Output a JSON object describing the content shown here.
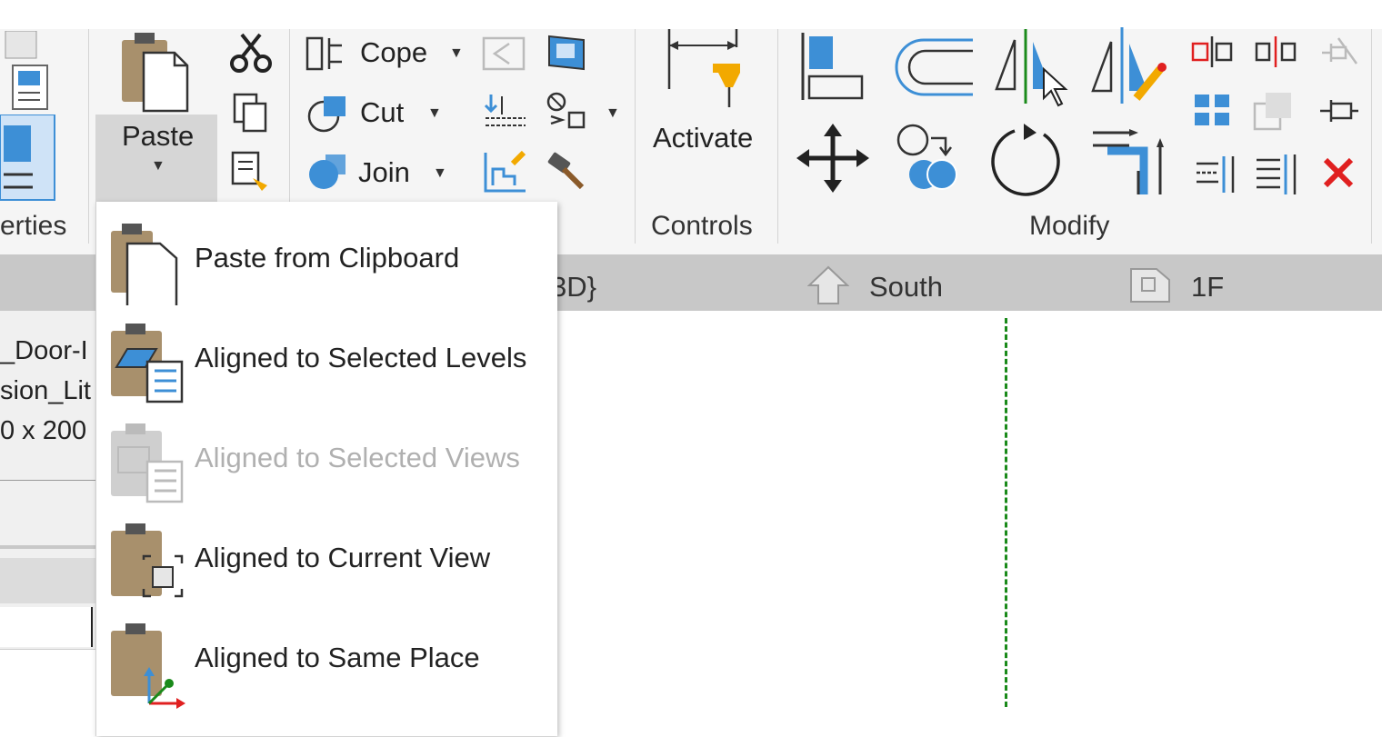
{
  "ribbon": {
    "properties_label": "erties",
    "paste_label": "Paste",
    "cope_label": "Cope",
    "cut_label": "Cut",
    "join_label": "Join",
    "activate_label": "Activate",
    "controls_label": "Controls",
    "modify_label": "Modify"
  },
  "view_tabs": {
    "tab_3d": "3D}",
    "tab_south": "South",
    "tab_1f": "1F"
  },
  "left_panel": {
    "line1": "_Door-I",
    "line2": "sion_Lit",
    "line3": "0 x 200"
  },
  "paste_menu": {
    "items": [
      {
        "label": "Paste from Clipboard",
        "enabled": true,
        "icon": "paste-clipboard-icon"
      },
      {
        "label": "Aligned to Selected Levels",
        "enabled": true,
        "icon": "paste-levels-icon"
      },
      {
        "label": "Aligned to Selected Views",
        "enabled": false,
        "icon": "paste-views-icon"
      },
      {
        "label": "Aligned to Current View",
        "enabled": true,
        "icon": "paste-current-view-icon"
      },
      {
        "label": "Aligned to Same Place",
        "enabled": true,
        "icon": "paste-same-place-icon"
      }
    ]
  },
  "colors": {
    "accent_blue": "#3d8fd6",
    "clipboard_brown": "#a8906c",
    "delete_red": "#e02020",
    "pin_orange": "#f2a900",
    "grid_green": "#1a8a1a"
  }
}
